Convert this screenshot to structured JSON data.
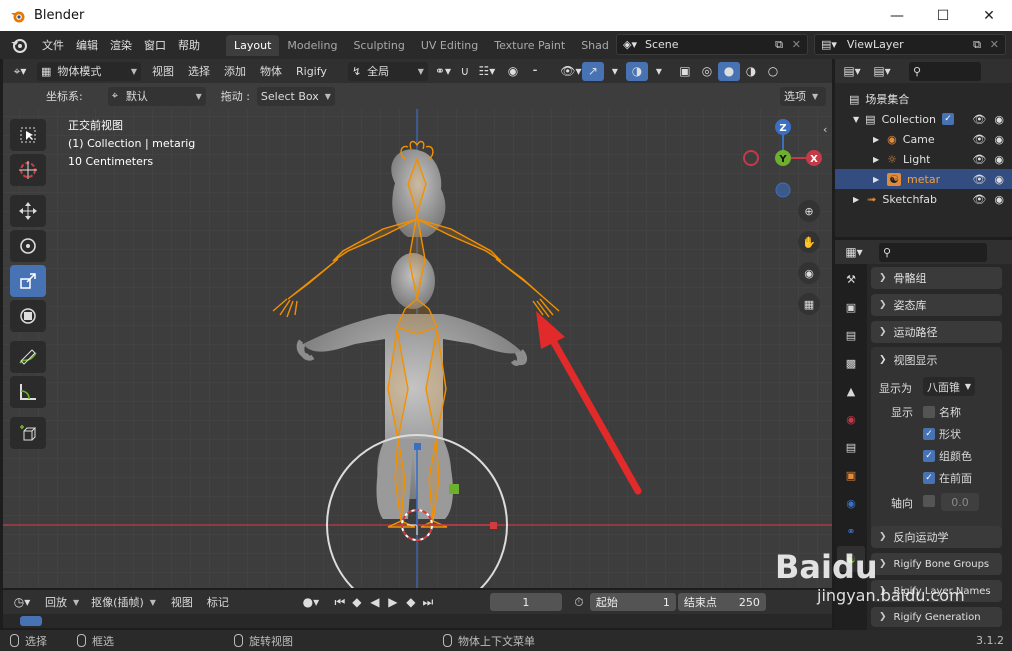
{
  "window": {
    "title": "Blender",
    "minimize_icon": "minimize-icon",
    "maximize_icon": "maximize-icon",
    "close_icon": "close-icon"
  },
  "menubar": {
    "menus": [
      "文件",
      "编辑",
      "渲染",
      "窗口",
      "帮助"
    ],
    "workspaces": [
      "Layout",
      "Modeling",
      "Sculpting",
      "UV Editing",
      "Texture Paint",
      "Shad"
    ],
    "active_workspace": "Layout",
    "scene": "Scene",
    "view_layer": "ViewLayer"
  },
  "viewport_header": {
    "mode": "物体模式",
    "menus": [
      "视图",
      "选择",
      "添加",
      "物体",
      "Rigify"
    ],
    "transform_orientation": "全局"
  },
  "viewport_header2": {
    "coord_label": "坐标系:",
    "coord_value": "默认",
    "drag_label": "拖动 :",
    "drag_value": "Select Box",
    "options_label": "选项"
  },
  "viewport_overlay": {
    "view_name": "正交前视图",
    "collection_line": "(1) Collection | metarig",
    "scale_line": "10 Centimeters"
  },
  "gizmo": {
    "x": "X",
    "y": "Y",
    "z": "Z"
  },
  "timeline": {
    "playback": "回放",
    "keying": "抠像(插帧)",
    "view": "视图",
    "marker": "标记",
    "current_frame": "1",
    "start_label": "起始",
    "start_value": "1",
    "end_label": "结束点",
    "end_value": "250"
  },
  "statusbar": {
    "select": "选择",
    "box_select": "框选",
    "rotate_view": "旋转视图",
    "context_menu": "物体上下文菜单",
    "version": "3.1.2"
  },
  "outliner": {
    "root": "场景集合",
    "items": [
      {
        "name": "Collection",
        "icon": "collection-icon"
      },
      {
        "name": "Camer",
        "icon": "camera-icon"
      },
      {
        "name": "Light",
        "icon": "light-icon"
      },
      {
        "name": "metar",
        "icon": "armature-icon"
      },
      {
        "name": "Sketchfab",
        "icon": "empty-icon"
      }
    ]
  },
  "properties": {
    "panels": [
      "骨骼组",
      "姿态库",
      "运动路径"
    ],
    "open_panel": "视图显示",
    "display_as_label": "显示为",
    "display_as_value": "八面锥",
    "show_label": "显示",
    "show_options": [
      {
        "label": "名称",
        "checked": false
      },
      {
        "label": "形状",
        "checked": true
      },
      {
        "label": "组颜色",
        "checked": true
      },
      {
        "label": "在前面",
        "checked": true
      }
    ],
    "axes_label": "轴向",
    "axes_value": "0.0",
    "after_panels": [
      "反向运动学",
      "Rigify Bone Groups",
      "Rigify Layer Names",
      "Rigify Generation"
    ]
  },
  "watermark": {
    "brand": "Baidu",
    "sub": "jingyan.baidu.com"
  },
  "colors": {
    "accent": "#4772b3",
    "selection_orange": "#f29000",
    "axis_red": "#c43a48",
    "axis_green": "#6db02d",
    "axis_blue": "#3b6fc4",
    "annotation_arrow": "#e22a2a"
  }
}
